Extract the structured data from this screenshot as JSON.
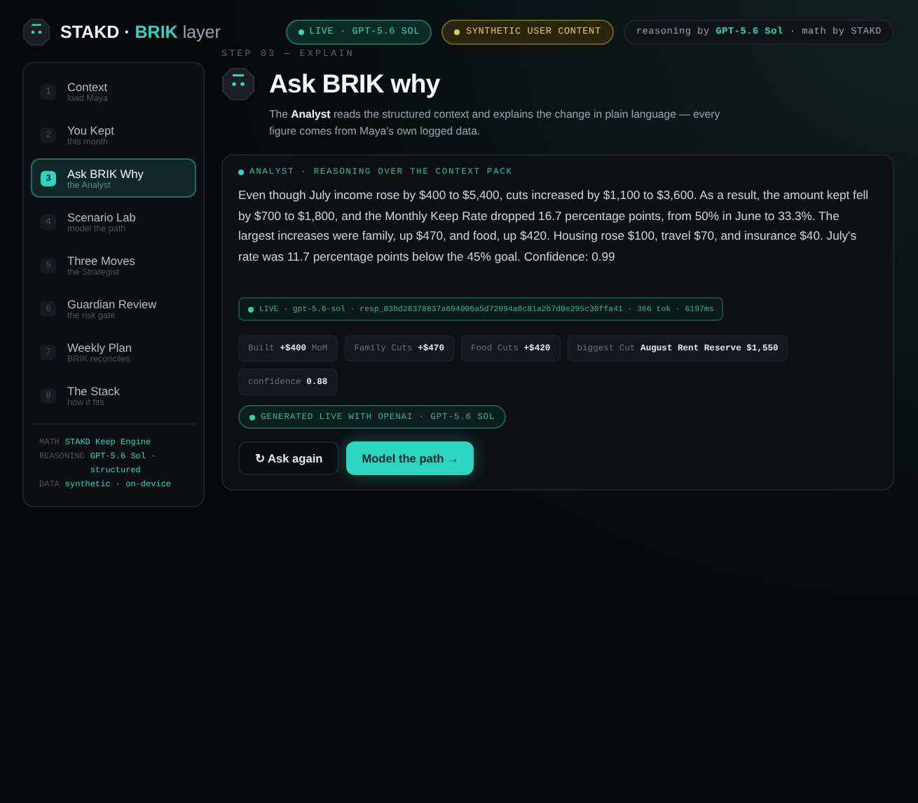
{
  "brand": {
    "name": "STAKD",
    "separator": "·",
    "product": "BRIK",
    "suffix": "layer"
  },
  "header_pills": [
    {
      "kind": "live",
      "text": "LIVE · GPT-5.6 SOL"
    },
    {
      "kind": "warning",
      "text": "SYNTHETIC USER CONTENT"
    },
    {
      "kind": "info",
      "text": "reasoning by **GPT-5.6 Sol** · math by STAKD"
    }
  ],
  "sidebar": {
    "items": [
      {
        "number": "1",
        "title": "Context",
        "subtitle": "load Maya",
        "selected": false
      },
      {
        "number": "2",
        "title": "You Kept",
        "subtitle": "this month",
        "selected": false
      },
      {
        "number": "3",
        "title": "Ask BRIK Why",
        "subtitle": "the Analyst",
        "selected": true
      },
      {
        "number": "4",
        "title": "Scenario Lab",
        "subtitle": "model the path",
        "selected": false
      },
      {
        "number": "5",
        "title": "Three Moves",
        "subtitle": "the Strategist",
        "selected": false
      },
      {
        "number": "6",
        "title": "Guardian Review",
        "subtitle": "the risk gate",
        "selected": false
      },
      {
        "number": "7",
        "title": "Weekly Plan",
        "subtitle": "BRIK reconciles",
        "selected": false
      },
      {
        "number": "8",
        "title": "The Stack",
        "subtitle": "how it fits",
        "selected": false
      }
    ],
    "footer": [
      {
        "label": "MATH",
        "value": "STAKD Keep Engine"
      },
      {
        "label": "REASONING",
        "value": "GPT-5.6 Sol · structured"
      },
      {
        "label": "DATA",
        "value": "synthetic · on-device"
      }
    ]
  },
  "step_label": "STEP 03 — EXPLAIN",
  "title": "Ask BRIK why",
  "description": "The **Analyst** reads the structured context and explains the change in plain language — every figure comes from Maya's own logged data.",
  "card": {
    "label": "ANALYST · REASONING OVER THE CONTEXT PACK",
    "explanation": "Even though July income rose by $400 to $5,400, cuts increased by $1,100 to $3,600. As a result, the amount kept fell by $700 to $1,800, and the Monthly Keep Rate dropped 16.7 percentage points, from 50% in June to 33.3%. The largest increases were family, up $470, and food, up $420. Housing rose $100, travel $70, and insurance $40. July's rate was 11.7 percentage points below the 45% goal. Confidence: 0.99",
    "response_meta": "LIVE · gpt-5.6-sol · resp_03bd28378837a694006a5d72094a0c81a2b7d0e295c30ffa41 · 366 tok · 6197ms",
    "chips": [
      "Built **+$400** MoM",
      "Family Cuts **+$470**",
      "Food Cuts **+$420**",
      "biggest Cut **August Rent Reserve $1,550**",
      "confidence **0.88**"
    ],
    "generated_badge": "GENERATED LIVE WITH OPENAI · GPT-5.6 SOL",
    "buttons": [
      {
        "kind": "secondary",
        "icon": "↻",
        "label": "Ask again"
      },
      {
        "kind": "primary",
        "label": "Model the path →"
      }
    ]
  }
}
